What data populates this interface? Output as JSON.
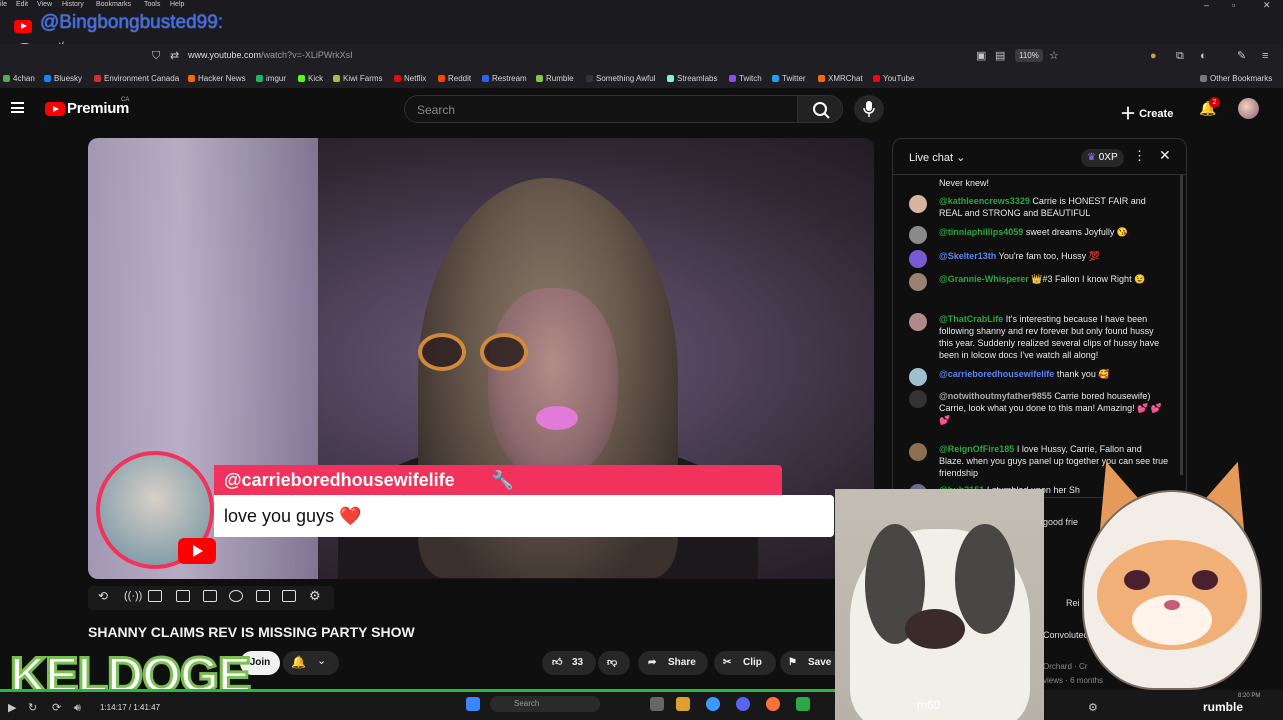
{
  "menu": [
    "ile",
    "Edit",
    "View",
    "History",
    "Bookmarks",
    "Tools",
    "Help"
  ],
  "overlay_username": "@Bingbongbusted99:",
  "overlay_emojis": [
    "😂",
    "👏"
  ],
  "browser": {
    "url_host": "www.youtube.com",
    "url_path": "/watch?v=-XLiPWrkXsI",
    "zoom": "110%"
  },
  "bookmarks": [
    {
      "label": "4chan",
      "color": "#4caf50"
    },
    {
      "label": "Bluesky",
      "color": "#1185fe"
    },
    {
      "label": "Environment Canada",
      "color": "#d32f2f"
    },
    {
      "label": "Hacker News",
      "color": "#ff6600"
    },
    {
      "label": "imgur",
      "color": "#1bb76e"
    },
    {
      "label": "Kick",
      "color": "#53fc18"
    },
    {
      "label": "Kiwi Farms",
      "color": "#a0c040"
    },
    {
      "label": "Netflix",
      "color": "#e50914"
    },
    {
      "label": "Reddit",
      "color": "#ff4500"
    },
    {
      "label": "Restream",
      "color": "#2962ff"
    },
    {
      "label": "Rumble",
      "color": "#85c742"
    },
    {
      "label": "Something Awful",
      "color": "#333333"
    },
    {
      "label": "Streamlabs",
      "color": "#80f5d2"
    },
    {
      "label": "Twitch",
      "color": "#9146ff"
    },
    {
      "label": "Twitter",
      "color": "#1da1f2"
    },
    {
      "label": "XMRChat",
      "color": "#ff6600"
    },
    {
      "label": "YouTube",
      "color": "#ff0000"
    }
  ],
  "other_bookmarks": "Other Bookmarks",
  "youtube": {
    "brand": "Premium",
    "region": "CA",
    "search_placeholder": "Search",
    "create_label": "Create",
    "notifications": "2"
  },
  "highlight": {
    "author": "@carrieboredhousewifelife",
    "message": "love you guys ❤️"
  },
  "video": {
    "title": "SHANNY CLAIMS REV IS MISSING PARTY SHOW",
    "join_label": "Join",
    "likes": "33",
    "share_label": "Share",
    "clip_label": "Clip",
    "save_label": "Save",
    "time": "1:14:17 / 1:41:47"
  },
  "streamer_tag": "KELDOGE",
  "chat": {
    "title": "Live chat",
    "xp": "0XP",
    "messages": [
      {
        "author": "",
        "text": "Never knew!",
        "avatar_color": "#555555",
        "style": "green"
      },
      {
        "author": "@kathleencrews3329",
        "text": "Carrie is HONEST FAIR and REAL and STRONG and BEAUTIFUL",
        "avatar_color": "#d8b4a0",
        "style": "green"
      },
      {
        "author": "@tinniaphillips4059",
        "text": "sweet dreams Joyfully 😘",
        "avatar_color": "#8a8a8a",
        "style": "green"
      },
      {
        "author": "@Skelter13th",
        "text": "You're fam too, Hussy 💯",
        "avatar_color": "#7a5ad0",
        "style": "blue"
      },
      {
        "author": "@Grannie-Whisperer",
        "text": "👑#3 Fallon I know Right 😉",
        "avatar_color": "#9a8070",
        "style": "green"
      },
      {
        "author": "@ThatCrabLife",
        "text": "It's interesting because I have been following shanny and rev forever but only found hussy this year. Suddenly realized several clips of hussy have been in lolcow docs I've watch all along!",
        "avatar_color": "#b08a8a",
        "style": "green"
      },
      {
        "author": "@carrieboredhousewifelife",
        "text": "thank you 🥰",
        "avatar_color": "#a0c0d0",
        "style": "blue"
      },
      {
        "author": "@notwithoutmyfather9855",
        "text": "Carrie bored housewife) Carrie, look what you done to this man! Amazing! 💕 💕 💕",
        "avatar_color": "#333333",
        "style": "gray"
      },
      {
        "author": "@ReignOfFire185",
        "text": "I love Hussy, Carrie, Fallon and Blaze. when you guys panel up together you can see true friendship",
        "avatar_color": "#8a7050",
        "style": "green"
      },
      {
        "author": "@bub3151",
        "text": "I stumbled upon her Sh",
        "avatar_color": "#6a6a8a",
        "style": "green"
      },
      {
        "author": "",
        "text": "good frie",
        "avatar_color": "#444444",
        "style": "green"
      }
    ]
  },
  "recs": [
    {
      "text": "Rei"
    },
    {
      "text": "Convoluted C"
    },
    {
      "text": "Orchard · Cr"
    },
    {
      "text": "views · 6 months"
    }
  ],
  "cat_label": "m60",
  "rumble_label": "rumble",
  "clock": "8:20 PM",
  "taskbar_search": "Search"
}
